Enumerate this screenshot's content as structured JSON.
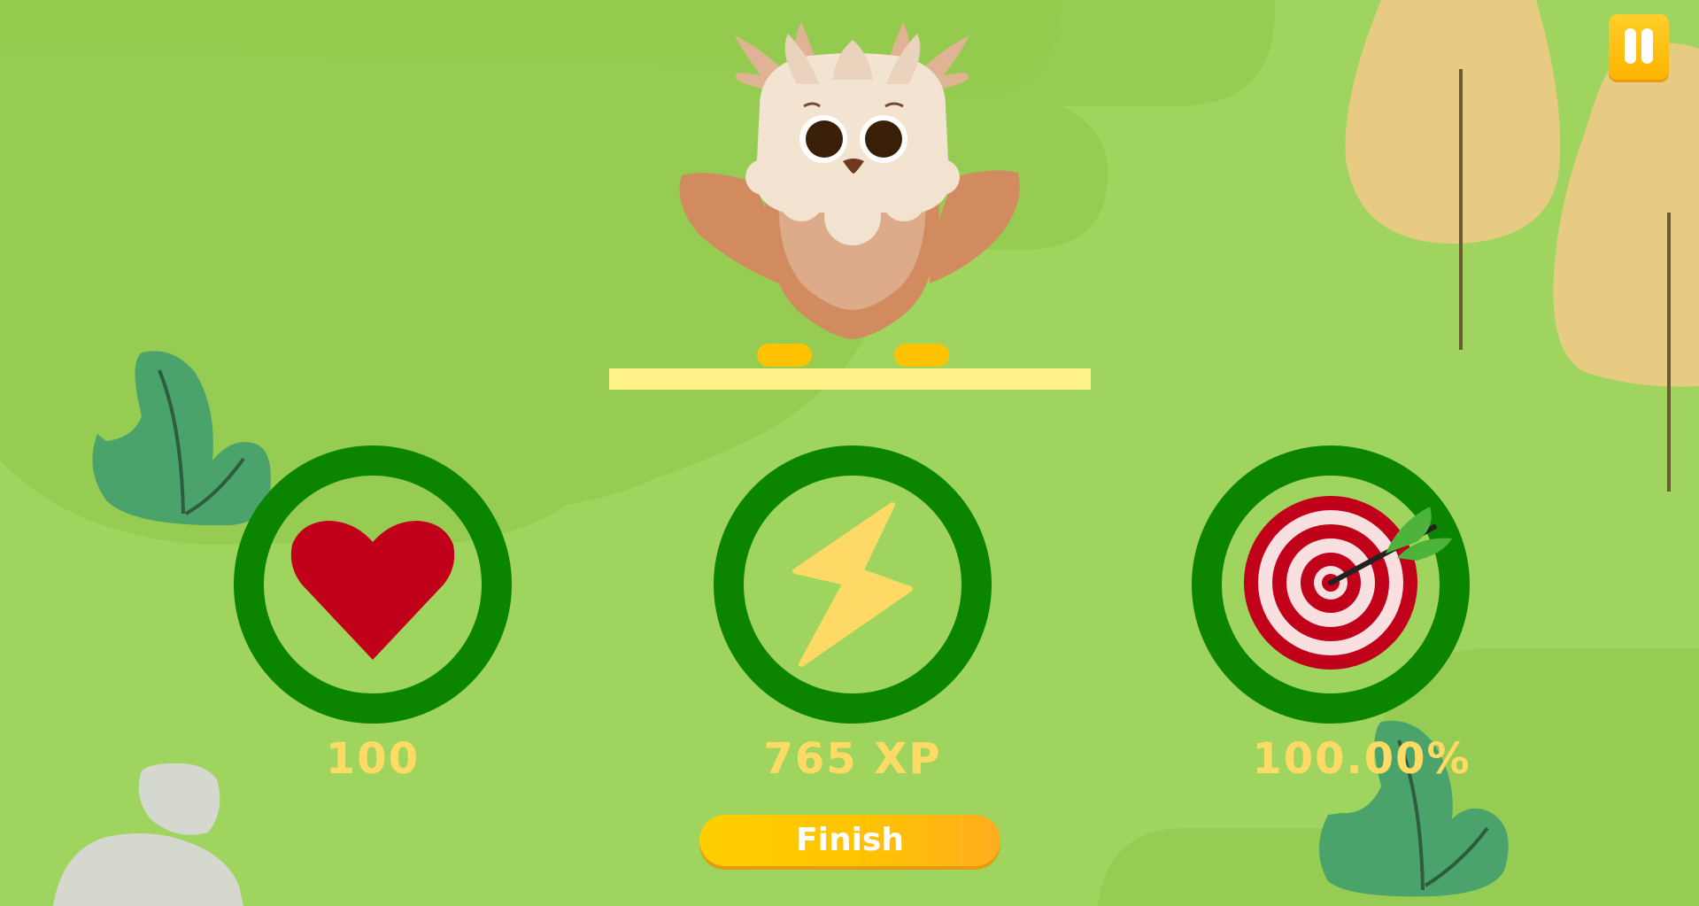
{
  "game": {
    "stats": {
      "lives": {
        "value": "100",
        "icon": "heart-icon",
        "color": "#c1001a"
      },
      "xp": {
        "value": "765 XP",
        "icon": "lightning-bolt-icon",
        "color": "#ffd966"
      },
      "accuracy": {
        "value": "100.00%",
        "icon": "target-with-arrow-icon",
        "color": "#c1001a"
      }
    },
    "finish_label": "Finish",
    "pause_icon": "pause-icon",
    "mascot": "owl",
    "colors": {
      "background": "#9fd55e",
      "ring": "#0b8500",
      "stat_text": "#ffdb66",
      "button": "#ffc400"
    }
  }
}
